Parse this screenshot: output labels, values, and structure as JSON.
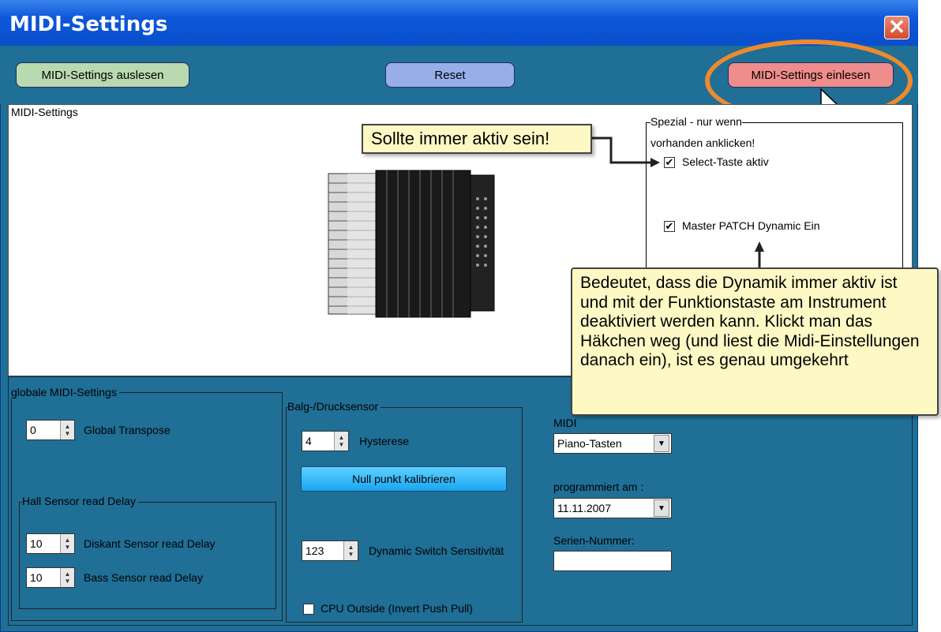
{
  "window": {
    "title": "MIDI-Settings",
    "close_symbol": "✕"
  },
  "toolbar": {
    "read_label": "MIDI-Settings auslesen",
    "reset_label": "Reset",
    "write_label": "MIDI-Settings einlesen"
  },
  "midi_settings": {
    "group_label": "MIDI-Settings",
    "spezial_label_line1": "Spezial - nur wenn",
    "spezial_label_line2": "vorhanden anklicken!",
    "select_key_label": "Select-Taste aktiv",
    "select_key_checked": "✔",
    "master_patch_label": "Master PATCH Dynamic Ein",
    "master_patch_checked": "✔"
  },
  "callouts": {
    "top": "Sollte immer aktiv sein!",
    "bottom": "Bedeutet, dass die Dynamik immer aktiv ist und mit der Funktionstaste am Instrument deaktiviert werden kann. Klickt man das Häkchen weg (und liest die Midi-Einstellungen danach ein), ist es genau umgekehrt"
  },
  "global": {
    "group_label": "globale MIDI-Settings",
    "transpose_value": "0",
    "transpose_label": "Global Transpose",
    "hall_group_label": "Hall Sensor read Delay",
    "diskant_value": "10",
    "diskant_label": "Diskant Sensor read Delay",
    "bass_value": "10",
    "bass_label": "Bass Sensor read Delay"
  },
  "balg": {
    "group_label": "Balg-/Drucksensor",
    "hysterese_value": "4",
    "hysterese_label": "Hysterese",
    "null_button": "Null punkt kalibrieren",
    "dynamic_value": "123",
    "dynamic_label": "Dynamic Switch Sensitivität",
    "cpu_label": "CPU Outside (Invert Push Pull)"
  },
  "midi_side": {
    "midi_label": "MIDI",
    "midi_select": "Piano-Tasten",
    "programmed_label": "programmiert am :",
    "programmed_select": "11.11.2007",
    "serial_label": "Serien-Nummer:",
    "serial_value": ""
  },
  "colors": {
    "accent_orange": "#ee8a2b",
    "callout_bg": "#fdf8c4",
    "window_bg": "#1f6f96"
  }
}
